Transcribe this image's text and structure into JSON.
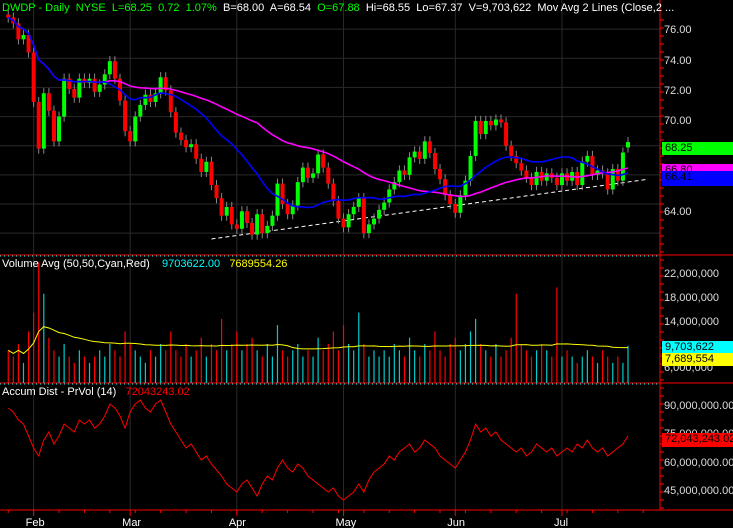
{
  "header": {
    "symbol": "DWDP - Daily",
    "exchange": "NYSE",
    "last": "L=68.25",
    "change": "0.72",
    "change_pct": "1.07%",
    "bid": "B=68.00",
    "ask": "A=68.54",
    "open": "O=67.88",
    "high": "Hi=68.55",
    "low": "Lo=67.37",
    "volume": "V=9,703,622",
    "study": "Mov Avg 2 Lines (Close,2 ..."
  },
  "volume_panel": {
    "title": "Volume Avg (50,50,Cyan,Red)",
    "value1": "9703622.00",
    "value2": "7689554.26",
    "badge_volume": "9,703,622",
    "badge_avg": "7,689,554",
    "ticks": [
      "22,000,000",
      "18,000,000",
      "14,000,000",
      "6,000,000"
    ]
  },
  "ad_panel": {
    "title": "Accum Dist - PrVol (14)",
    "value": "72043243.02",
    "badge": "72,043,243.02",
    "ticks": [
      "90,000,000.00",
      "75,000,000.00",
      "60,000,000.00",
      "45,000,000.00"
    ]
  },
  "price_panel": {
    "ticks": [
      "76.00",
      "74.00",
      "72.00",
      "70.00",
      "64.00"
    ],
    "badge_last": "68.25",
    "badge_ma_long": "66.80",
    "badge_ma_short": "66.41"
  },
  "colors": {
    "up": "#00ff00",
    "down": "#ff0000",
    "ma_short": "#0000ff",
    "ma_long": "#ff00ff",
    "vol_up": "#00cccc",
    "vol_avg": "#ffff00",
    "ad": "#ff0000",
    "axis": "#ff0000"
  },
  "chart_data": {
    "type": "candlestick",
    "months": [
      {
        "label": "Feb",
        "start": 5
      },
      {
        "label": "Mar",
        "start": 24
      },
      {
        "label": "Apr",
        "start": 45
      },
      {
        "label": "May",
        "start": 66
      },
      {
        "label": "Jun",
        "start": 88
      },
      {
        "label": "Jul",
        "start": 109
      }
    ],
    "price_ylim": [
      60.5,
      78
    ],
    "close": [
      76.8,
      76.4,
      75.3,
      75.6,
      74.4,
      71.0,
      67.8,
      71.6,
      70.4,
      68.3,
      70.0,
      72.6,
      71.9,
      71.3,
      72.6,
      72.3,
      72.6,
      71.7,
      72.2,
      72.9,
      73.8,
      72.6,
      71.1,
      69.0,
      68.3,
      70.0,
      70.8,
      71.5,
      71.0,
      71.6,
      72.7,
      71.8,
      70.3,
      68.9,
      68.4,
      67.9,
      68.1,
      67.1,
      66.2,
      66.9,
      65.3,
      64.4,
      63.2,
      63.8,
      62.6,
      62.3,
      63.5,
      62.7,
      61.9,
      63.3,
      62.0,
      62.5,
      63.2,
      65.4,
      64.0,
      63.3,
      63.9,
      65.5,
      66.5,
      65.8,
      66.1,
      67.4,
      66.5,
      65.4,
      64.2,
      63.0,
      62.4,
      63.3,
      63.8,
      64.4,
      62.0,
      62.6,
      63.0,
      63.6,
      64.1,
      65.0,
      65.5,
      66.3,
      66.0,
      67.2,
      67.6,
      67.1,
      68.3,
      67.5,
      66.4,
      65.7,
      64.6,
      64.0,
      63.4,
      64.6,
      65.6,
      67.3,
      69.7,
      68.8,
      69.7,
      69.4,
      69.8,
      69.6,
      68.0,
      67.3,
      66.8,
      66.3,
      65.8,
      65.3,
      66.2,
      65.6,
      66.1,
      65.8,
      65.3,
      66.1,
      65.6,
      66.2,
      65.3,
      66.9,
      67.3,
      66.0,
      66.3,
      66.1,
      65.0,
      66.4,
      65.6,
      67.53,
      68.25
    ],
    "open": [
      77.0,
      76.8,
      76.4,
      75.3,
      75.6,
      74.4,
      71.0,
      67.8,
      71.6,
      70.4,
      68.3,
      70.0,
      72.6,
      71.9,
      71.3,
      72.6,
      72.3,
      72.6,
      71.7,
      72.2,
      72.9,
      73.8,
      72.6,
      71.1,
      69.0,
      68.3,
      70.0,
      70.8,
      71.5,
      71.0,
      71.6,
      72.7,
      71.8,
      70.3,
      68.9,
      68.4,
      67.9,
      68.1,
      67.1,
      66.2,
      66.9,
      65.3,
      64.4,
      63.2,
      63.8,
      62.6,
      62.3,
      63.5,
      62.7,
      61.9,
      63.3,
      62.0,
      62.5,
      63.2,
      65.4,
      64.0,
      63.3,
      63.9,
      65.5,
      66.5,
      65.8,
      66.1,
      67.4,
      66.5,
      65.4,
      64.2,
      63.0,
      62.4,
      63.3,
      63.8,
      64.4,
      62.0,
      62.6,
      63.0,
      63.6,
      64.1,
      65.0,
      65.5,
      66.3,
      66.0,
      67.2,
      67.6,
      67.1,
      68.3,
      67.5,
      66.4,
      65.7,
      64.6,
      64.0,
      63.4,
      64.6,
      65.6,
      67.3,
      69.7,
      68.8,
      69.7,
      69.4,
      69.8,
      69.6,
      68.0,
      67.3,
      66.8,
      66.3,
      65.8,
      65.3,
      66.2,
      65.6,
      66.1,
      65.8,
      65.3,
      66.1,
      65.6,
      66.2,
      65.3,
      66.9,
      67.3,
      66.0,
      66.3,
      66.1,
      65.0,
      66.4,
      65.6,
      67.88
    ],
    "ma_periods": [
      20,
      50
    ],
    "trendline": {
      "from": {
        "bar": 40,
        "price": 61.6
      },
      "to": {
        "bar": 126,
        "price": 65.7
      }
    },
    "volume_millions": [
      9,
      8,
      10,
      7,
      12,
      15,
      23,
      18,
      11,
      9,
      8,
      10,
      8,
      7,
      9,
      8,
      7,
      8,
      9,
      8,
      10,
      9,
      8,
      12,
      10,
      9,
      8,
      7,
      9,
      8,
      10,
      9,
      12,
      9,
      8,
      10,
      8,
      9,
      11,
      8,
      10,
      9,
      14,
      9,
      10,
      12,
      9,
      10,
      11,
      9,
      8,
      10,
      8,
      13,
      9,
      8,
      9,
      10,
      8,
      9,
      8,
      11,
      9,
      10,
      12,
      9,
      13,
      10,
      9,
      15,
      10,
      8,
      9,
      8,
      9,
      8,
      10,
      9,
      8,
      11,
      9,
      8,
      10,
      9,
      12,
      9,
      8,
      10,
      11,
      9,
      10,
      12,
      14,
      10,
      9,
      8,
      10,
      8,
      9,
      11,
      18,
      10,
      9,
      8,
      9,
      10,
      9,
      8,
      19,
      8,
      9,
      8,
      7,
      8,
      9,
      8,
      7,
      9,
      8,
      7,
      8,
      7,
      9.7
    ],
    "volume_ylim_millions": [
      3.8,
      24
    ],
    "volume_avg_period": 50,
    "ad_millions": [
      86,
      84,
      80,
      78,
      72,
      66,
      62,
      70,
      74,
      68,
      72,
      78,
      76,
      74,
      80,
      78,
      80,
      76,
      78,
      82,
      88,
      86,
      82,
      76,
      84,
      88,
      90,
      86,
      84,
      88,
      90,
      84,
      78,
      74,
      70,
      66,
      68,
      64,
      60,
      62,
      58,
      55,
      52,
      48,
      46,
      44,
      48,
      50,
      46,
      42,
      48,
      52,
      50,
      56,
      60,
      56,
      54,
      58,
      56,
      52,
      50,
      48,
      46,
      44,
      46,
      42,
      40,
      42,
      44,
      48,
      44,
      50,
      54,
      56,
      58,
      62,
      60,
      64,
      66,
      68,
      64,
      66,
      70,
      68,
      66,
      62,
      60,
      58,
      56,
      60,
      64,
      70,
      78,
      74,
      76,
      72,
      74,
      70,
      68,
      66,
      64,
      66,
      62,
      64,
      68,
      66,
      64,
      66,
      62,
      64,
      66,
      64,
      68,
      66,
      70,
      66,
      64,
      66,
      62,
      64,
      66,
      68,
      72.04
    ],
    "ad_ylim_millions": [
      35,
      98
    ]
  }
}
